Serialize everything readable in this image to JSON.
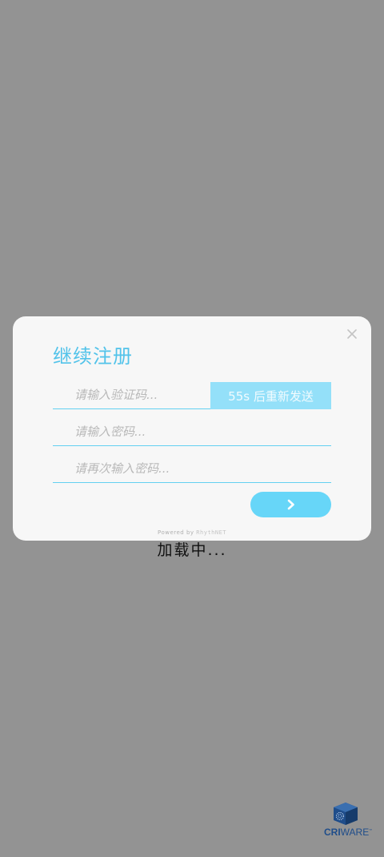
{
  "loading_text": "加载中...",
  "dialog": {
    "title": "继续注册",
    "verification_placeholder": "请输入验证码...",
    "resend_label": "55s 后重新发送",
    "password_placeholder": "请输入密码...",
    "confirm_password_placeholder": "请再次输入密码...",
    "powered_prefix": "Powered by",
    "powered_brand": "RhythNET"
  },
  "branding": {
    "cri": "CRI",
    "ware": "WARE",
    "tm": "™"
  },
  "colors": {
    "accent": "#52c3ea",
    "resend_bg": "#94e0f9",
    "next_bg": "#67d6f8",
    "overlay": "#939393"
  },
  "icons": {
    "close": "close-icon",
    "next": "chevron-right-icon",
    "logo": "criware-logo-icon"
  }
}
